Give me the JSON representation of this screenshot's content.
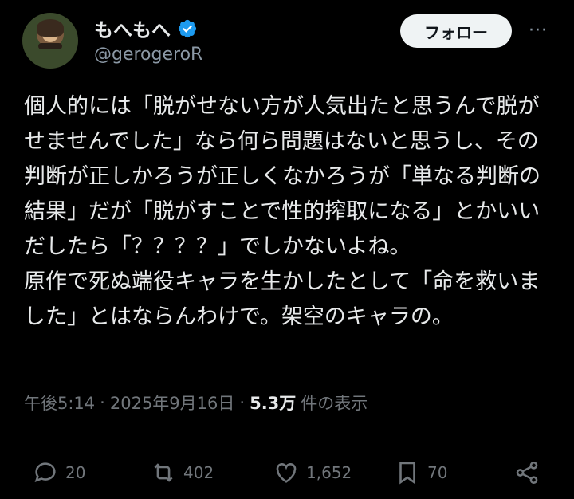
{
  "user": {
    "display_name": "もへもへ",
    "handle": "@gerogeroR"
  },
  "follow_label": "フォロー",
  "more_label": "···",
  "tweet_text": "個人的には「脱がせない方が人気出たと思うんで脱がせませんでした」なら何ら問題はないと思うし、その判断が正しかろうが正しくなかろうが「単なる判断の結果」だが「脱がすことで性的搾取になる」とかいいだしたら「？？？？」でしかないよね。\n原作で死ぬ端役キャラを生かしたとして「命を救いました」とはならんわけで。架空のキャラの。",
  "meta": {
    "time": "午後5:14",
    "sep1": "·",
    "date": "2025年9月16日",
    "sep2": "·",
    "views": "5.3万",
    "views_label": "件の表示"
  },
  "actions": {
    "reply_count": "20",
    "retweet_count": "402",
    "like_count": "1,652",
    "bookmark_count": "70"
  },
  "colors": {
    "verified": "#1d9bf0",
    "muted": "#71767b"
  }
}
